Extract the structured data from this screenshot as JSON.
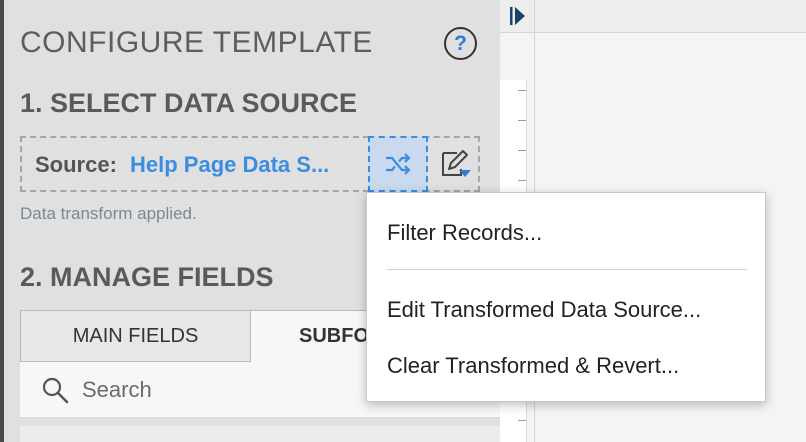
{
  "panel": {
    "title": "CONFIGURE TEMPLATE",
    "help_label": "?",
    "section1_title": "1. SELECT DATA SOURCE",
    "source": {
      "label": "Source:",
      "value": "Help Page Data S...",
      "shuffle_icon": "shuffle-icon",
      "edit_icon": "edit-data-source-icon"
    },
    "transform_note": "Data transform applied.",
    "section2_title": "2. MANAGE FIELDS",
    "tabs": [
      {
        "label": "MAIN FIELDS"
      },
      {
        "label": "SUBFO"
      }
    ],
    "search": {
      "placeholder": "Search",
      "value": ""
    }
  },
  "dropdown": {
    "items": [
      {
        "label": "Filter Records..."
      },
      {
        "label": "Edit Transformed Data Source..."
      },
      {
        "label": "Clear Transformed & Revert..."
      }
    ]
  },
  "colors": {
    "accent": "#3a8de0",
    "panel_bg": "#e0e0e0",
    "note": "#7a8896"
  }
}
